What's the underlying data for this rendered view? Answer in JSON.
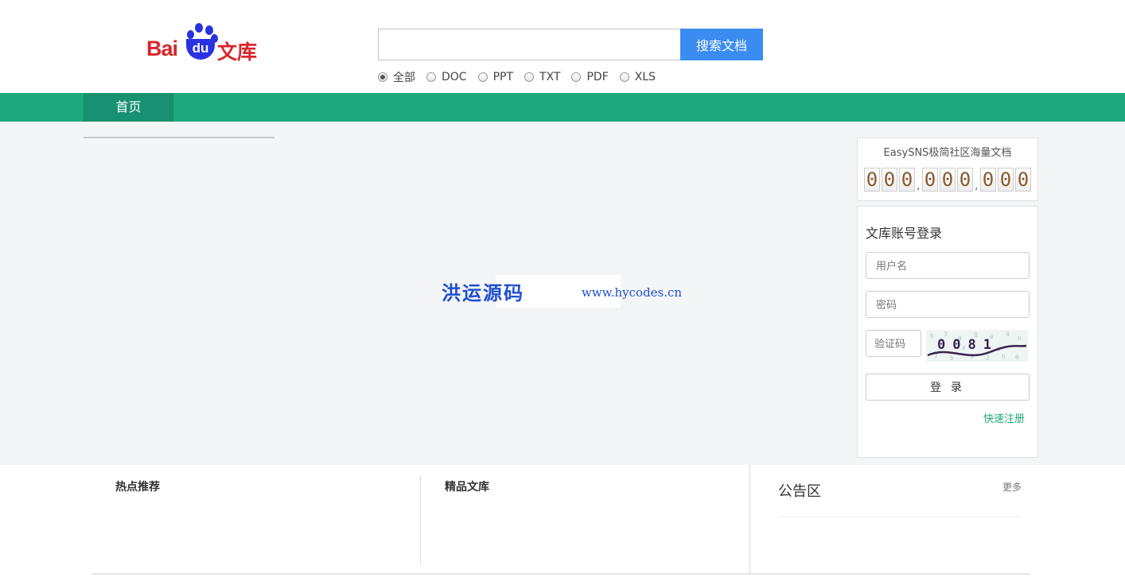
{
  "header": {
    "logo": {
      "bai": "Bai",
      "du": "du",
      "wenku": "文库"
    },
    "search": {
      "placeholder": "",
      "button_label": "搜索文档"
    },
    "doc_types": [
      {
        "label": "全部",
        "selected": true
      },
      {
        "label": "DOC",
        "selected": false
      },
      {
        "label": "PPT",
        "selected": false
      },
      {
        "label": "TXT",
        "selected": false
      },
      {
        "label": "PDF",
        "selected": false
      },
      {
        "label": "XLS",
        "selected": false
      }
    ]
  },
  "nav": {
    "home_label": "首页"
  },
  "watermark": {
    "cn": "洪运源码",
    "url": "www.hycodes.cn"
  },
  "counter": {
    "title": "EasySNS极简社区海量文档",
    "groups": [
      [
        "0",
        "0",
        "0"
      ],
      [
        "0",
        "0",
        "0"
      ],
      [
        "0",
        "0",
        "0"
      ]
    ],
    "separator": ","
  },
  "login": {
    "title": "文库账号登录",
    "username_placeholder": "用户名",
    "password_placeholder": "密码",
    "captcha_placeholder": "验证码",
    "captcha_text": "0081",
    "submit_label": "登 录",
    "register_label": "快速注册"
  },
  "bottom": {
    "hot_title": "热点推荐",
    "featured_title": "精品文库",
    "notice_title": "公告区",
    "more_label": "更多"
  },
  "colors": {
    "brand_green": "#1ea97c",
    "search_blue": "#3b8cf0",
    "logo_red": "#d9252b",
    "logo_blue": "#2932e1"
  }
}
